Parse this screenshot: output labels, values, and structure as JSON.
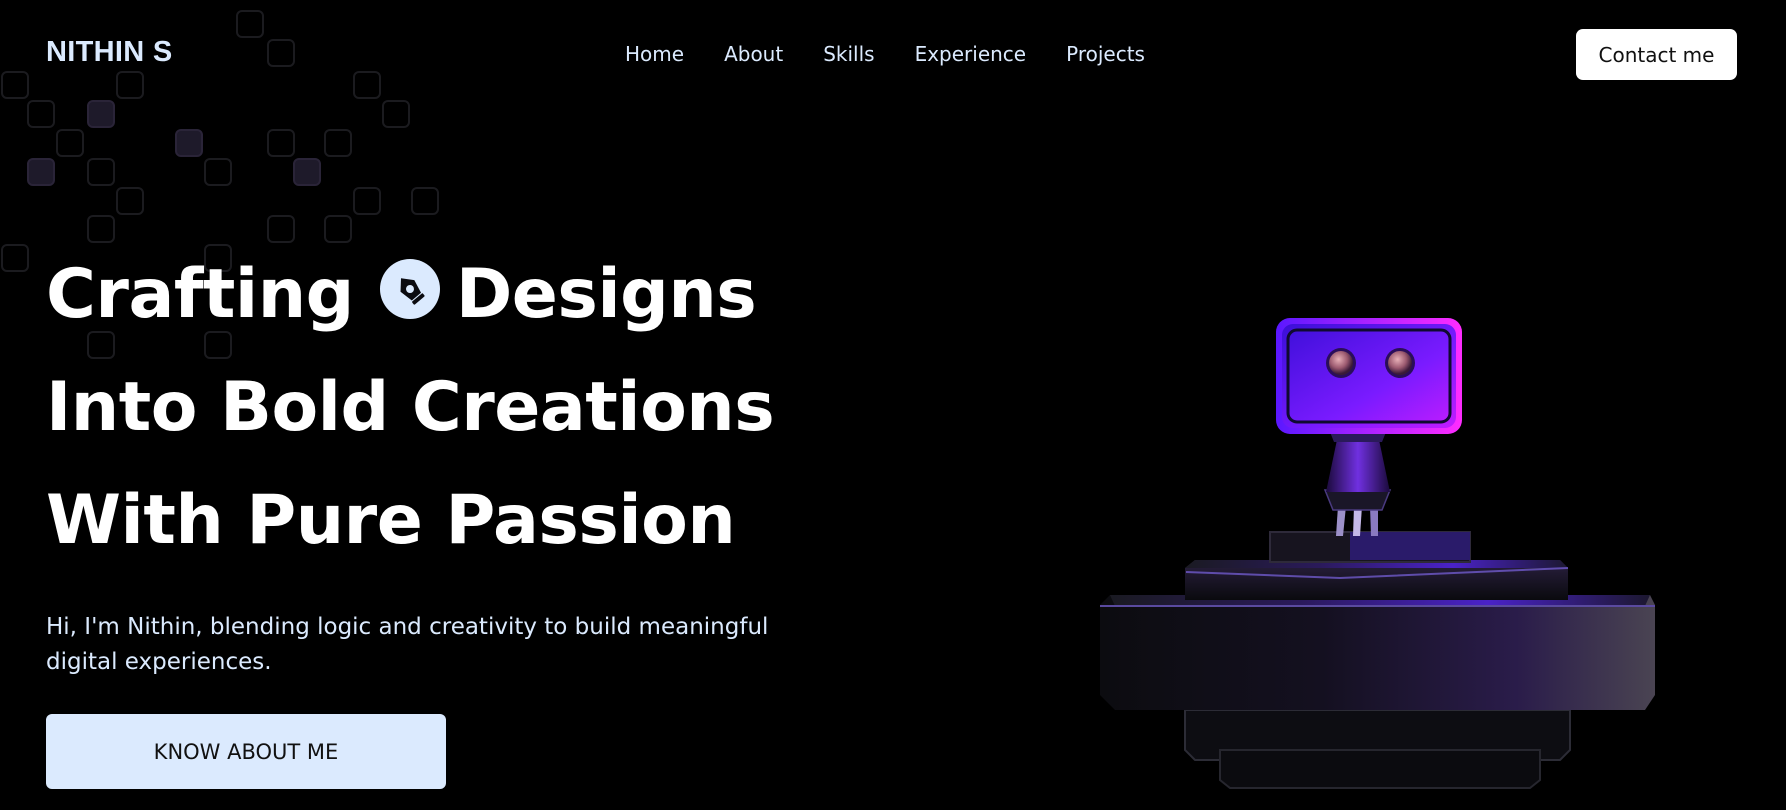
{
  "header": {
    "brand": "NITHIN S",
    "nav": [
      "Home",
      "About",
      "Skills",
      "Experience",
      "Projects"
    ],
    "contact_label": "Contact me"
  },
  "hero": {
    "line1_a": "Crafting",
    "line1_b": "Designs",
    "line2": "Into Bold Creations",
    "line3": "With Pure Passion",
    "subtitle": "Hi, I'm Nithin, blending logic and creativity to build meaningful digital experiences.",
    "cta_label": "KNOW ABOUT ME",
    "badge_icon": "pen-tool-icon"
  },
  "illustration": {
    "icon": "robot-illustration"
  },
  "colors": {
    "background": "#000000",
    "accent_light": "#dbeafe",
    "robot_purple": "#7c1cff",
    "robot_magenta": "#d01cff"
  }
}
